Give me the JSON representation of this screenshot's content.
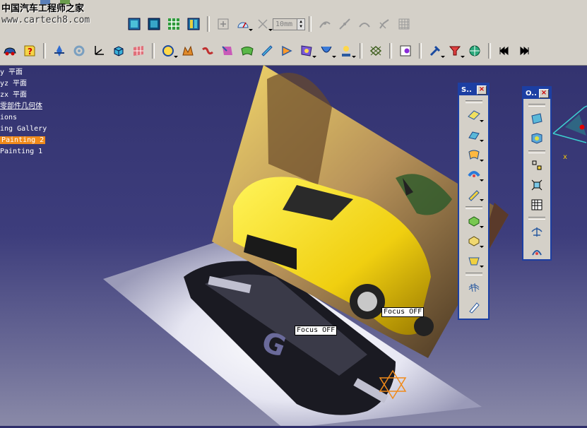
{
  "watermark": {
    "line1": "中国汽车工程师之家",
    "line2": "www.cartech8.com"
  },
  "toolbar": {
    "length_field_value": "10mm"
  },
  "tree": {
    "items": [
      {
        "label": "y 平面"
      },
      {
        "label": "yz 平面"
      },
      {
        "label": "zx 平面"
      },
      {
        "label": "零部件几何体"
      },
      {
        "label": "ions"
      },
      {
        "label": "ing Gallery"
      },
      {
        "label": "Painting 2"
      },
      {
        "label": "Painting 1"
      }
    ]
  },
  "viewport": {
    "focus_labels": [
      "Focus OFF",
      "Focus OFF"
    ],
    "axis_label": "x"
  },
  "float_toolbars": {
    "left": {
      "title": "S.."
    },
    "right": {
      "title": "O.."
    }
  },
  "colors": {
    "accent": "#f08a1a",
    "titlebar": "#1c3fa3",
    "toolbar_bg": "#d4d0c8"
  }
}
